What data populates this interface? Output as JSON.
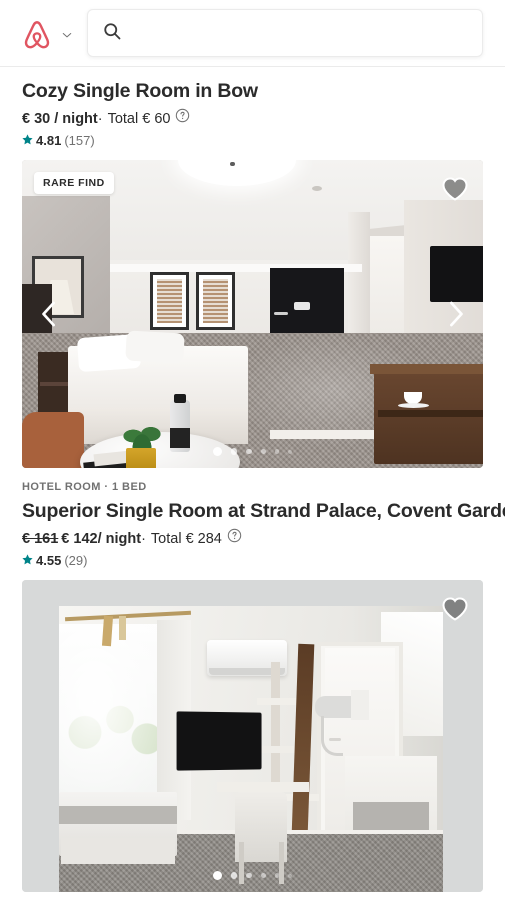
{
  "header": {
    "logo_name": "airbnb-logo",
    "account_chevron": "chevron-down-icon",
    "search": {
      "icon": "search-icon",
      "value": "",
      "placeholder": ""
    }
  },
  "colors": {
    "brand": "#e05561",
    "rating_star": "#008489",
    "text_primary": "#2b2b2b",
    "text_muted": "#717171",
    "border": "#ebebeb",
    "photo_letterbox": "#d7d9d9"
  },
  "listings": [
    {
      "kicker": "",
      "title": "Cozy Single Room in Bow",
      "price_strike": "",
      "price_now": "€ 30 / night",
      "price_separator": "·",
      "price_total": "Total € 60",
      "help_icon": "help-circle-icon",
      "rating_value": "4.81",
      "rating_count": "(157)",
      "badge": "RARE FIND",
      "favorite_icon": "heart-icon",
      "prev_icon": "chevron-left-icon",
      "next_icon": "chevron-right-icon",
      "photo_dots": 6,
      "photo_active_dot": 1
    },
    {
      "kicker": "HOTEL ROOM · 1 BED",
      "title": "Superior Single Room at Strand Palace, Covent Garden",
      "price_strike": "€ 161",
      "price_now": "€ 142/ night",
      "price_separator": "·",
      "price_total": "Total € 284",
      "help_icon": "help-circle-icon",
      "rating_value": "4.55",
      "rating_count": "(29)",
      "badge": "",
      "favorite_icon": "heart-icon",
      "prev_icon": "",
      "next_icon": "",
      "photo_dots": 6,
      "photo_active_dot": 1
    }
  ]
}
